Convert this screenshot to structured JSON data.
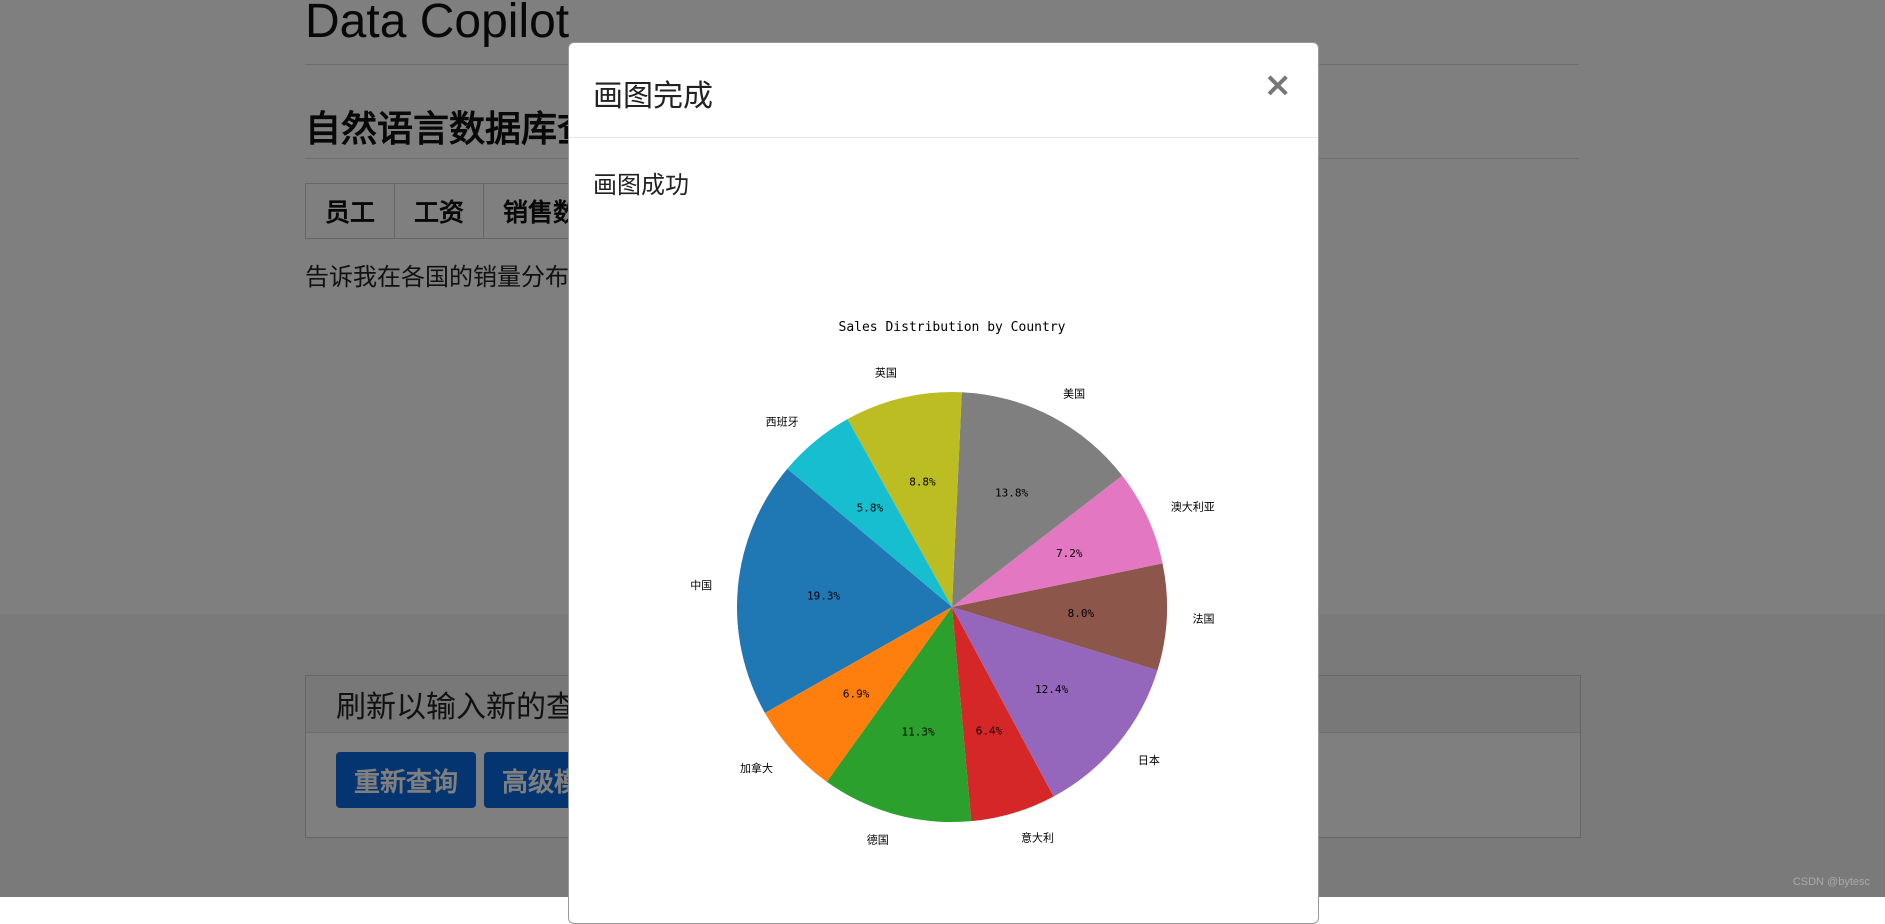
{
  "app": {
    "title": "Data Copilot"
  },
  "page": {
    "section_title": "自然语言数据库查",
    "tabs": [
      {
        "label": "员工"
      },
      {
        "label": "工资"
      },
      {
        "label": "销售数"
      }
    ],
    "query_text": "告诉我在各国的销量分布",
    "bottom_panel": {
      "heading": "刷新以输入新的查",
      "buttons": [
        {
          "label": "重新查询"
        },
        {
          "label": "高级模"
        }
      ]
    }
  },
  "modal": {
    "title": "画图完成",
    "close_label": "×",
    "message": "画图成功"
  },
  "chart_data": {
    "type": "pie",
    "title": "Sales Distribution by Country",
    "categories": [
      "中国",
      "加拿大",
      "德国",
      "意大利",
      "日本",
      "法国",
      "澳大利亚",
      "美国",
      "英国",
      "西班牙"
    ],
    "values": [
      19.3,
      6.9,
      11.3,
      6.4,
      12.4,
      8.0,
      7.2,
      13.8,
      8.8,
      5.8
    ],
    "labels": [
      "19.3%",
      "6.9%",
      "11.3%",
      "6.4%",
      "12.4%",
      "8.0%",
      "7.2%",
      "13.8%",
      "8.8%",
      "5.8%"
    ],
    "colors": [
      "#1f77b4",
      "#ff7f0e",
      "#2ca02c",
      "#d62728",
      "#9467bd",
      "#8c564b",
      "#e377c2",
      "#7f7f7f",
      "#bcbd22",
      "#17becf"
    ],
    "start_angle": 140,
    "direction": "counterclockwise"
  },
  "watermark": "CSDN @bytesc"
}
